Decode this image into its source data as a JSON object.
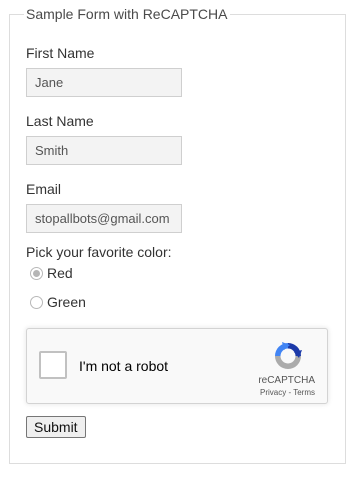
{
  "form": {
    "legend": "Sample Form with ReCAPTCHA",
    "first_name": {
      "label": "First Name",
      "value": "Jane"
    },
    "last_name": {
      "label": "Last Name",
      "value": "Smith"
    },
    "email": {
      "label": "Email",
      "value": "stopallbots@gmail.com"
    },
    "color_question": "Pick your favorite color:",
    "color_options": [
      {
        "label": "Red",
        "checked": true
      },
      {
        "label": "Green",
        "checked": false
      }
    ],
    "submit_label": "Submit"
  },
  "recaptcha": {
    "checkbox_label": "I'm not a robot",
    "brand": "reCAPTCHA",
    "privacy_link": "Privacy",
    "separator": " - ",
    "terms_link": "Terms",
    "colors": {
      "blue": "#1c3aa9",
      "light_blue": "#4285f4",
      "gray": "#ababab"
    }
  }
}
